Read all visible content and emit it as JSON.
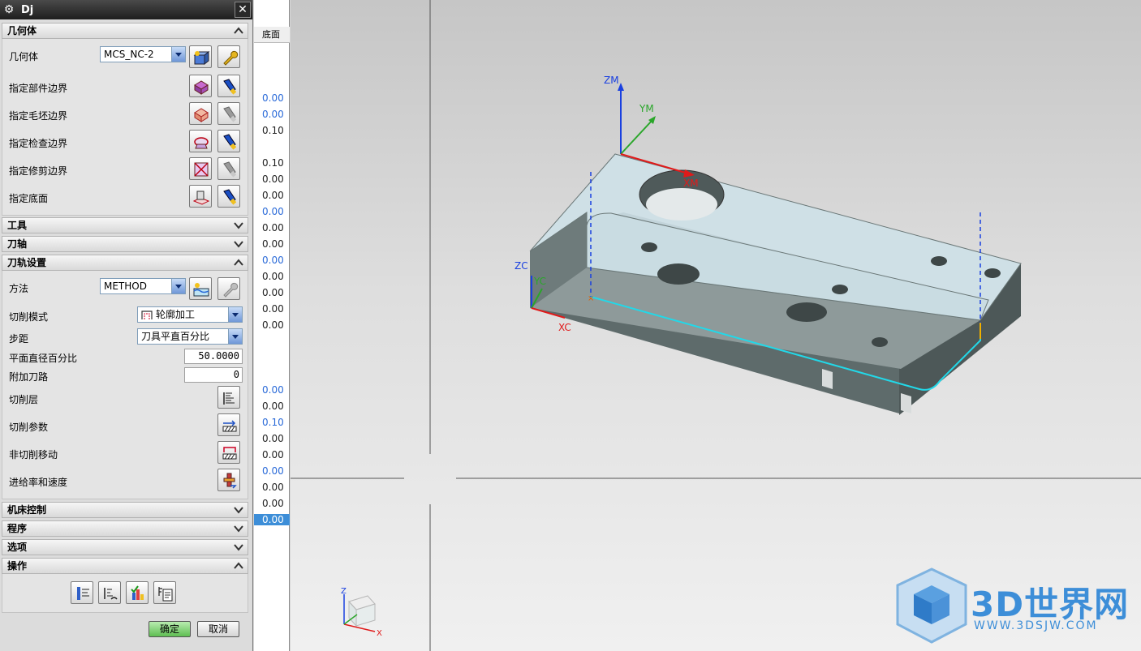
{
  "dialog": {
    "title": "Dj",
    "close_symbol": "✕",
    "sections": {
      "geometry": {
        "label": "几何体",
        "expanded": true
      },
      "tool": {
        "label": "工具",
        "expanded": false
      },
      "tool_axis": {
        "label": "刀轴",
        "expanded": false
      },
      "path_settings": {
        "label": "刀轨设置",
        "expanded": true
      },
      "machine_control": {
        "label": "机床控制",
        "expanded": false
      },
      "program": {
        "label": "程序",
        "expanded": false
      },
      "options": {
        "label": "选项",
        "expanded": false
      },
      "actions": {
        "label": "操作",
        "expanded": true
      }
    },
    "geometry": {
      "geometry_label": "几何体",
      "geometry_value": "MCS_NC-2",
      "part_boundary": "指定部件边界",
      "blank_boundary": "指定毛坯边界",
      "check_boundary": "指定检查边界",
      "trim_boundary": "指定修剪边界",
      "floor": "指定底面"
    },
    "path_settings": {
      "method_label": "方法",
      "method_value": "METHOD",
      "cut_pattern_label": "切削模式",
      "cut_pattern_value": "轮廓加工",
      "stepover_label": "步距",
      "stepover_value": "刀具平直百分比",
      "percent_label": "平面直径百分比",
      "percent_value": "50.0000",
      "additional_passes_label": "附加刀路",
      "additional_passes_value": "0",
      "cut_levels": "切削层",
      "cut_params": "切削参数",
      "non_cutting": "非切削移动",
      "feeds_speeds": "进给率和速度"
    },
    "buttons": {
      "ok": "确定",
      "cancel": "取消"
    }
  },
  "table_column": {
    "header": "底面",
    "values": [
      "0.00",
      "0.00",
      "0.10",
      "0.10",
      "0.00",
      "0.00",
      "0.00",
      "0.00",
      "0.00",
      "0.00",
      "0.00",
      "0.00",
      "0.00",
      "0.00",
      "0.00",
      "0.00",
      "0.10",
      "0.00",
      "0.00",
      "0.00",
      "0.00",
      "0.00",
      "0.00"
    ],
    "selected_index": 22
  },
  "viewport": {
    "axis_labels": {
      "zm": "ZM",
      "ym": "YM",
      "xm": "XM",
      "zc": "ZC",
      "yc": "YC",
      "xc": "XC"
    },
    "triad_labels": {
      "z": "Z",
      "x": "X"
    },
    "watermark": {
      "brand": "3D世界网",
      "url": "WWW.3DSJW.COM"
    }
  },
  "colors": {
    "accent": "#3d8ed8",
    "toolpath": "#22d8e8",
    "part_top": "#cfe0e6",
    "part_side": "#5e6b6b"
  }
}
